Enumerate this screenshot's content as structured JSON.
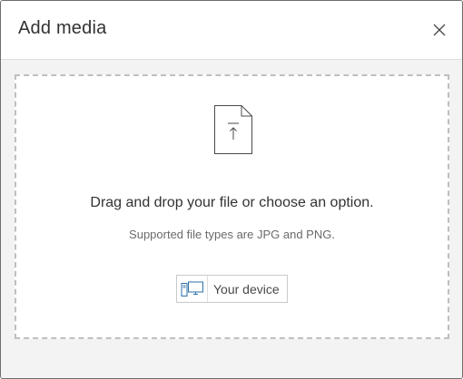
{
  "dialog": {
    "title": "Add media",
    "close_icon": "close-icon"
  },
  "dropzone": {
    "icon": "file-upload-icon",
    "headline": "Drag and drop your file or choose an option.",
    "subtext": "Supported file types are JPG and PNG."
  },
  "device_button": {
    "icon": "device-icon",
    "label": "Your device"
  },
  "colors": {
    "text_primary": "#323232",
    "text_secondary": "#6a6a6a",
    "panel_background": "#f3f3f3",
    "dashed_border": "#bfbfbf"
  }
}
